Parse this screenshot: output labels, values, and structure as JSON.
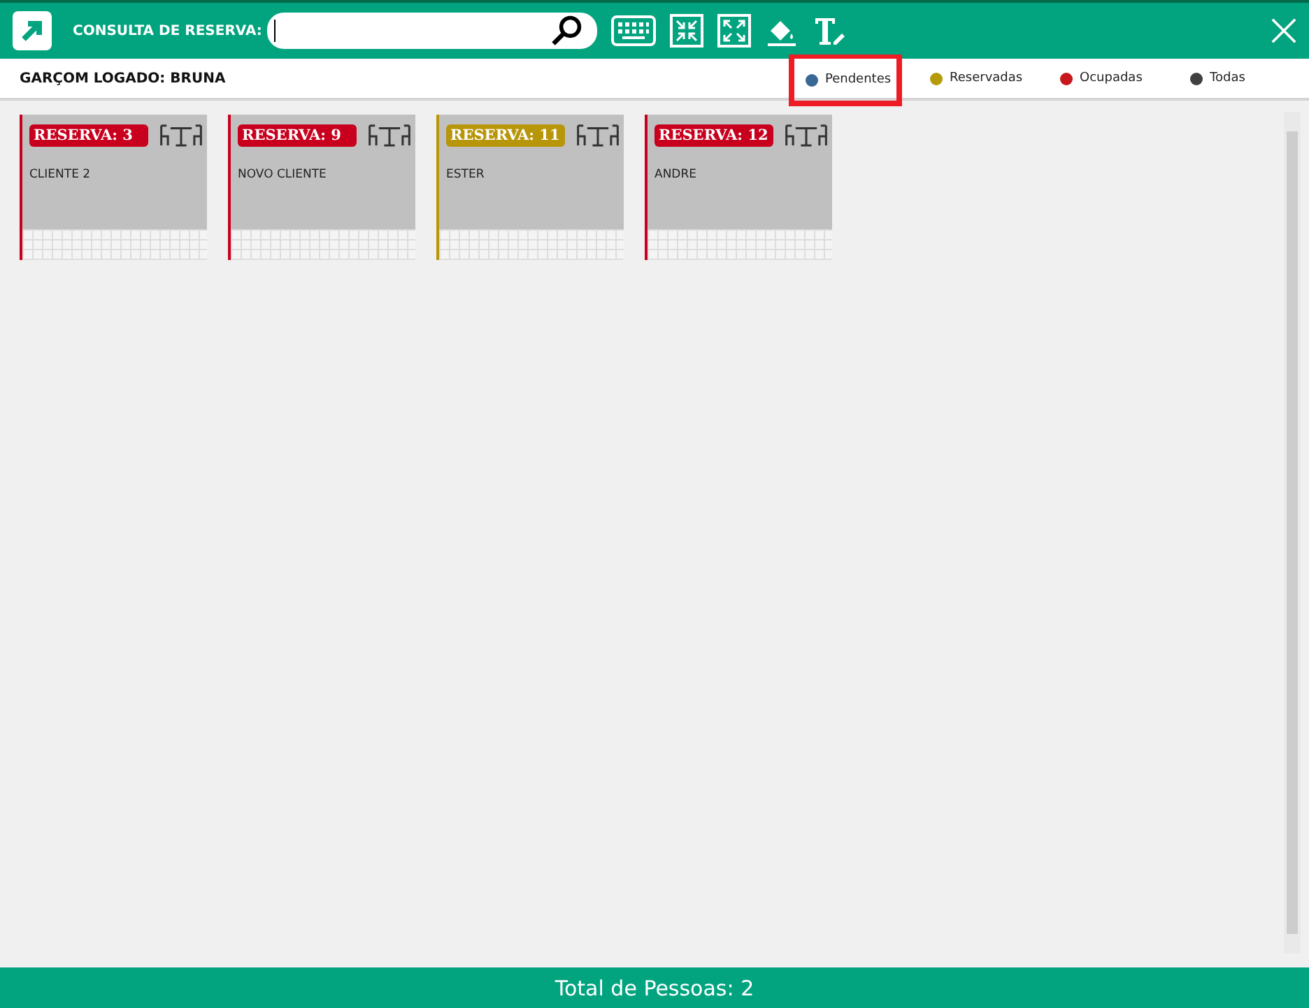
{
  "header": {
    "search_label": "CONSULTA DE RESERVA:"
  },
  "waiter": "GARÇOM LOGADO: BRUNA",
  "filters": [
    {
      "label": "Pendentes",
      "color": "#3a6896",
      "selected": true
    },
    {
      "label": "Reservadas",
      "color": "#b59a0a",
      "selected": false
    },
    {
      "label": "Ocupadas",
      "color": "#c8161d",
      "selected": false
    },
    {
      "label": "Todas",
      "color": "#404040",
      "selected": false
    }
  ],
  "reservations": [
    {
      "label": "RESERVA: 3",
      "client": "CLIENTE 2",
      "color": "#c8001e"
    },
    {
      "label": "RESERVA: 9",
      "client": "NOVO CLIENTE",
      "color": "#c8001e"
    },
    {
      "label": "RESERVA: 11",
      "client": "ESTER",
      "color": "#b8960a"
    },
    {
      "label": "RESERVA: 12",
      "client": "ANDRE",
      "color": "#c8001e"
    }
  ],
  "footer": "Total de Pessoas: 2"
}
